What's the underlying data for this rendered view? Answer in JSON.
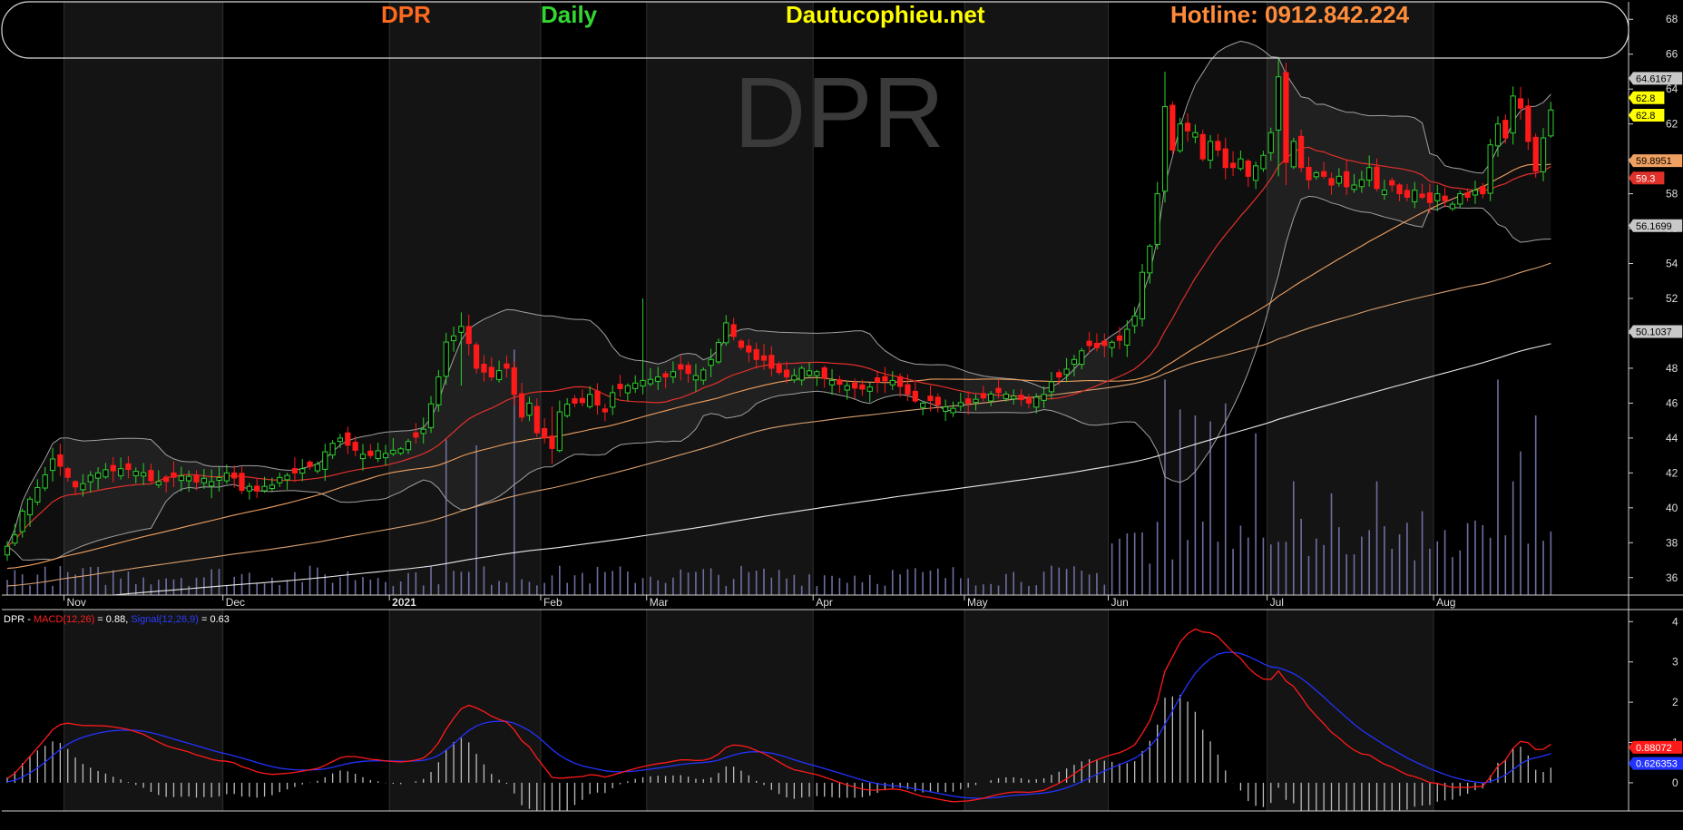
{
  "header": {
    "ticker": "DPR",
    "period": "Daily",
    "site": "Dautucophieu.net",
    "hotline": "Hotline: 0912.842.224"
  },
  "watermark": "DPR",
  "macd_label": {
    "prefix": "DPR - ",
    "macd": "MACD(12,26)",
    "macd_value": " = 0.88, ",
    "signal": "Signal(12,26,9)",
    "signal_value": " = 0.63"
  },
  "colors": {
    "background": "#000000",
    "up_candle": "#2ed12e",
    "down_candle": "#ff1a1a",
    "ma20": "#e0302a",
    "ma50": "#f0a060",
    "ma100": "#d9a070",
    "ma200": "#e8e8e8",
    "bollinger": "#a0a0a0",
    "volume": "#6e6ea0",
    "macd": "#ff1a1a",
    "signal": "#2233ff"
  },
  "price_badges": [
    {
      "text": "64.6167",
      "value": 64.6167,
      "bg": "#c8c8c8",
      "fg": "#000000"
    },
    {
      "text": "62.8",
      "value": 63.5,
      "bg": "#ffff00",
      "fg": "#000000"
    },
    {
      "text": "62.8",
      "value": 62.5,
      "bg": "#ffff00",
      "fg": "#000000"
    },
    {
      "text": "59.8951",
      "value": 59.8951,
      "bg": "#f0a060",
      "fg": "#000000"
    },
    {
      "text": "59.3",
      "value": 58.9,
      "bg": "#e0302a",
      "fg": "#ffffff"
    },
    {
      "text": "56.1699",
      "value": 56.1699,
      "bg": "#c8c8c8",
      "fg": "#000000"
    },
    {
      "text": "50.1037",
      "value": 50.1037,
      "bg": "#c8c8c8",
      "fg": "#000000"
    }
  ],
  "macd_badges": [
    {
      "text": "0.88072",
      "value": 0.88,
      "bg": "#ff1a1a",
      "fg": "#ffffff"
    },
    {
      "text": "0.626353",
      "value": 0.48,
      "bg": "#2233ff",
      "fg": "#ffffff"
    }
  ],
  "chart_data": [
    {
      "type": "candlestick",
      "title": "DPR Daily",
      "ylim": [
        35,
        69
      ],
      "y_ticks": [
        36,
        38,
        40,
        42,
        44,
        46,
        48,
        50,
        52,
        54,
        56,
        58,
        60,
        62,
        64,
        66,
        68
      ],
      "month_labels": [
        {
          "label": "Nov",
          "bar": 8
        },
        {
          "label": "Dec",
          "bar": 29
        },
        {
          "label": "2021",
          "bar": 51
        },
        {
          "label": "Feb",
          "bar": 71
        },
        {
          "label": "Mar",
          "bar": 85
        },
        {
          "label": "Apr",
          "bar": 107
        },
        {
          "label": "May",
          "bar": 127
        },
        {
          "label": "Jun",
          "bar": 146
        },
        {
          "label": "Jul",
          "bar": 167
        },
        {
          "label": "Aug",
          "bar": 189
        }
      ],
      "close_keypoints": [
        [
          0,
          37.8
        ],
        [
          3,
          40.5
        ],
        [
          6,
          42.8
        ],
        [
          9,
          41.2
        ],
        [
          12,
          42.0
        ],
        [
          16,
          42.2
        ],
        [
          20,
          41.5
        ],
        [
          24,
          41.8
        ],
        [
          27,
          41.5
        ],
        [
          29,
          42.0
        ],
        [
          31,
          41.0
        ],
        [
          35,
          41.3
        ],
        [
          38,
          42.0
        ],
        [
          41,
          42.5
        ],
        [
          44,
          44.0
        ],
        [
          46,
          43.3
        ],
        [
          48,
          43.0
        ],
        [
          51,
          43.3
        ],
        [
          53,
          43.8
        ],
        [
          55,
          44.5
        ],
        [
          57,
          47.5
        ],
        [
          58,
          49.5
        ],
        [
          60,
          50.4
        ],
        [
          62,
          48.0
        ],
        [
          64,
          47.5
        ],
        [
          66,
          48.0
        ],
        [
          67,
          46.5
        ],
        [
          68,
          45.2
        ],
        [
          69,
          46.0
        ],
        [
          70,
          44.3
        ],
        [
          71,
          44.0
        ],
        [
          72,
          43.4
        ],
        [
          73,
          45.5
        ],
        [
          75,
          46.0
        ],
        [
          77,
          46.5
        ],
        [
          79,
          45.5
        ],
        [
          80,
          46.6
        ],
        [
          82,
          47.0
        ],
        [
          84,
          47.3
        ],
        [
          86,
          47.5
        ],
        [
          88,
          47.8
        ],
        [
          90,
          47.7
        ],
        [
          92,
          47.9
        ],
        [
          93,
          48.5
        ],
        [
          95,
          50.6
        ],
        [
          97,
          49.2
        ],
        [
          99,
          48.5
        ],
        [
          101,
          48.0
        ],
        [
          103,
          47.5
        ],
        [
          105,
          48.0
        ],
        [
          107,
          47.8
        ],
        [
          109,
          47.3
        ],
        [
          111,
          47.0
        ],
        [
          113,
          46.8
        ],
        [
          115,
          47.2
        ],
        [
          117,
          47.3
        ],
        [
          119,
          46.5
        ],
        [
          121,
          46.0
        ],
        [
          123,
          45.9
        ],
        [
          125,
          45.7
        ],
        [
          127,
          46.0
        ],
        [
          129,
          46.3
        ],
        [
          131,
          46.6
        ],
        [
          133,
          46.4
        ],
        [
          135,
          46.0
        ],
        [
          137,
          46.5
        ],
        [
          139,
          47.5
        ],
        [
          141,
          48.5
        ],
        [
          143,
          49.3
        ],
        [
          145,
          49.3
        ],
        [
          147,
          49.6
        ],
        [
          149,
          51.0
        ],
        [
          150,
          53.5
        ],
        [
          151,
          55.0
        ],
        [
          152,
          58.0
        ],
        [
          153,
          63.0
        ],
        [
          154,
          60.5
        ],
        [
          155,
          62.0
        ],
        [
          156,
          61.6
        ],
        [
          157,
          61.5
        ],
        [
          158,
          60.0
        ],
        [
          159,
          61.0
        ],
        [
          160,
          60.5
        ],
        [
          161,
          59.5
        ],
        [
          162,
          59.5
        ],
        [
          163,
          60.0
        ],
        [
          164,
          59.0
        ],
        [
          165,
          59.6
        ],
        [
          166,
          60.2
        ],
        [
          167,
          61.5
        ],
        [
          168,
          64.7
        ],
        [
          169,
          59.8
        ],
        [
          170,
          61.0
        ],
        [
          171,
          59.5
        ],
        [
          172,
          58.8
        ],
        [
          173,
          59.2
        ],
        [
          174,
          59.0
        ],
        [
          175,
          58.5
        ],
        [
          176,
          59.0
        ],
        [
          177,
          58.4
        ],
        [
          178,
          58.5
        ],
        [
          179,
          58.8
        ],
        [
          180,
          59.5
        ],
        [
          181,
          58.3
        ],
        [
          182,
          58.2
        ],
        [
          183,
          58.5
        ],
        [
          184,
          58.0
        ],
        [
          185,
          57.8
        ],
        [
          186,
          58.2
        ],
        [
          187,
          57.8
        ],
        [
          188,
          57.5
        ],
        [
          189,
          58.0
        ],
        [
          190,
          57.6
        ],
        [
          191,
          57.4
        ],
        [
          192,
          58.0
        ],
        [
          193,
          57.8
        ],
        [
          194,
          58.2
        ],
        [
          195,
          58.0
        ],
        [
          196,
          60.8
        ],
        [
          197,
          62.0
        ],
        [
          198,
          61.2
        ],
        [
          199,
          63.6
        ],
        [
          200,
          62.9
        ],
        [
          201,
          61.0
        ],
        [
          202,
          59.3
        ],
        [
          203,
          61.2
        ],
        [
          204,
          62.8
        ]
      ],
      "volume_ylim": [
        0,
        5
      ],
      "volume_peaks": [
        [
          58,
          2.6
        ],
        [
          62,
          2.5
        ],
        [
          67,
          4.1
        ],
        [
          153,
          3.6
        ],
        [
          155,
          3.1
        ],
        [
          157,
          3.0
        ],
        [
          159,
          2.9
        ],
        [
          161,
          3.2
        ],
        [
          165,
          2.7
        ],
        [
          170,
          1.9
        ],
        [
          175,
          1.7
        ],
        [
          181,
          1.9
        ],
        [
          187,
          1.4
        ],
        [
          193,
          1.2
        ],
        [
          197,
          3.6
        ],
        [
          199,
          1.9
        ],
        [
          200,
          2.4
        ],
        [
          202,
          3.0
        ]
      ],
      "bollinger_period": 20,
      "bollinger_stdev": 2,
      "moving_averages": [
        20,
        50,
        100,
        200
      ]
    },
    {
      "type": "line",
      "title": "MACD(12,26)",
      "ylim": [
        -0.7,
        4.3
      ],
      "y_ticks": [
        0,
        1,
        2,
        3,
        4
      ],
      "series": [
        {
          "name": "MACD(12,26)",
          "color": "#ff1a1a"
        },
        {
          "name": "Signal(12,26,9)",
          "color": "#2233ff"
        }
      ]
    }
  ]
}
